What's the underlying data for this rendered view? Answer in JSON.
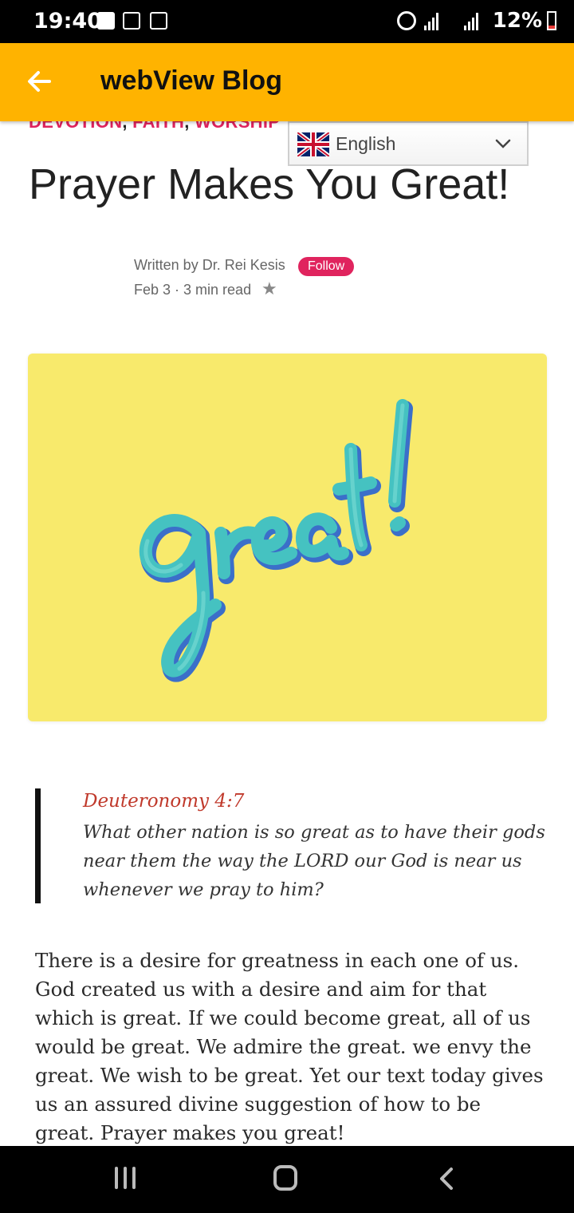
{
  "status_bar": {
    "time": "19:40",
    "battery_percent": "12%",
    "icons": [
      "checkbox-icon",
      "image-icon",
      "wifi-icon",
      "alarm-icon",
      "signal-icon",
      "hplus-data-icon",
      "signal-icon",
      "battery-low-icon"
    ]
  },
  "app_bar": {
    "title": "webView Blog",
    "back_icon": "arrow-left-icon",
    "background_color": "#ffb300"
  },
  "post": {
    "categories": [
      "DEVOTION",
      "FAITH",
      "WORSHIP"
    ],
    "category_color": "#e0245e",
    "title": "Prayer Makes You Great!",
    "author_line": "Written by Dr. Rei Kesis",
    "follow_label": "Follow",
    "date": "Feb 3",
    "read_time": "3 min read",
    "hero_image_text": "great!",
    "hero_background": "#f8ea6c"
  },
  "language_selector": {
    "flag_icon": "uk-flag-icon",
    "selected": "English"
  },
  "quote": {
    "reference": "Deuteronomy 4:7",
    "text": "What other nation is so great as to have their gods near them the way the LORD our God is near us whenever we pray to him?"
  },
  "body": {
    "paragraph_1": "There is a desire for greatness in each one of us. God created us with a desire and aim for that which is great. If we could become great, all of us would be great. We admire the great. we envy the great. We wish to be great. Yet our text today gives us an assured divine suggestion of how to be great. Prayer makes you great!"
  },
  "nav_bar": {
    "buttons": [
      "recents-icon",
      "home-icon",
      "back-icon"
    ]
  }
}
